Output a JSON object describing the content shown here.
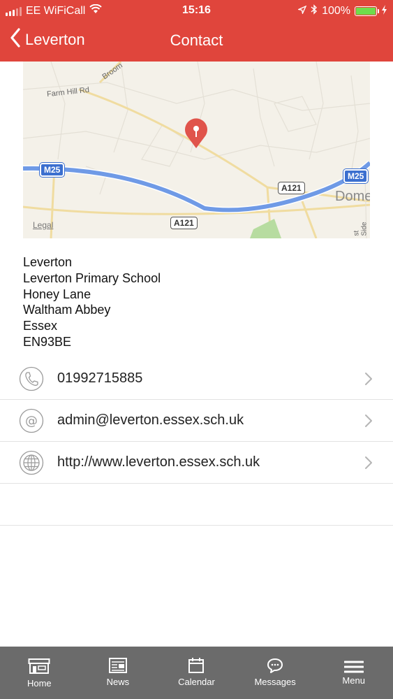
{
  "status_bar": {
    "carrier": "EE WiFiCall",
    "time": "15:16",
    "battery_percent": "100%",
    "battery_level": 1.0,
    "icons": [
      "signal-icon",
      "wifi-icon",
      "location-arrow-icon",
      "bluetooth-icon",
      "battery-icon",
      "charging-bolt-icon"
    ]
  },
  "nav": {
    "back_label": "Leverton",
    "title": "Contact"
  },
  "map": {
    "road_label_1": "Farm Hill Rd",
    "road_label_2": "Broom",
    "shield_m25_left": "M25",
    "shield_m25_right": "M25",
    "shield_a121_upper": "A121",
    "shield_a121_lower": "A121",
    "town_label": "Dome",
    "street_label": "st Side",
    "legal": "Legal",
    "colors": {
      "motorway": "#6f9ae6",
      "land": "#f4f1e9",
      "minor_road": "#f0dca0",
      "park": "#b7dca0",
      "pin": "#e0544b"
    }
  },
  "address": {
    "line1": "Leverton",
    "line2": "Leverton Primary School",
    "line3": "Honey Lane",
    "line4": "Waltham Abbey",
    "line5": "Essex",
    "line6": "EN93BE"
  },
  "contacts": {
    "phone": "01992715885",
    "email": "admin@leverton.essex.sch.uk",
    "website": "http://www.leverton.essex.sch.uk"
  },
  "tabs": {
    "home": "Home",
    "news": "News",
    "calendar": "Calendar",
    "messages": "Messages",
    "menu": "Menu"
  },
  "colors": {
    "header": "#e0453c",
    "tab_bar": "#6b6b6b",
    "battery_fill": "#6fdc4b"
  }
}
